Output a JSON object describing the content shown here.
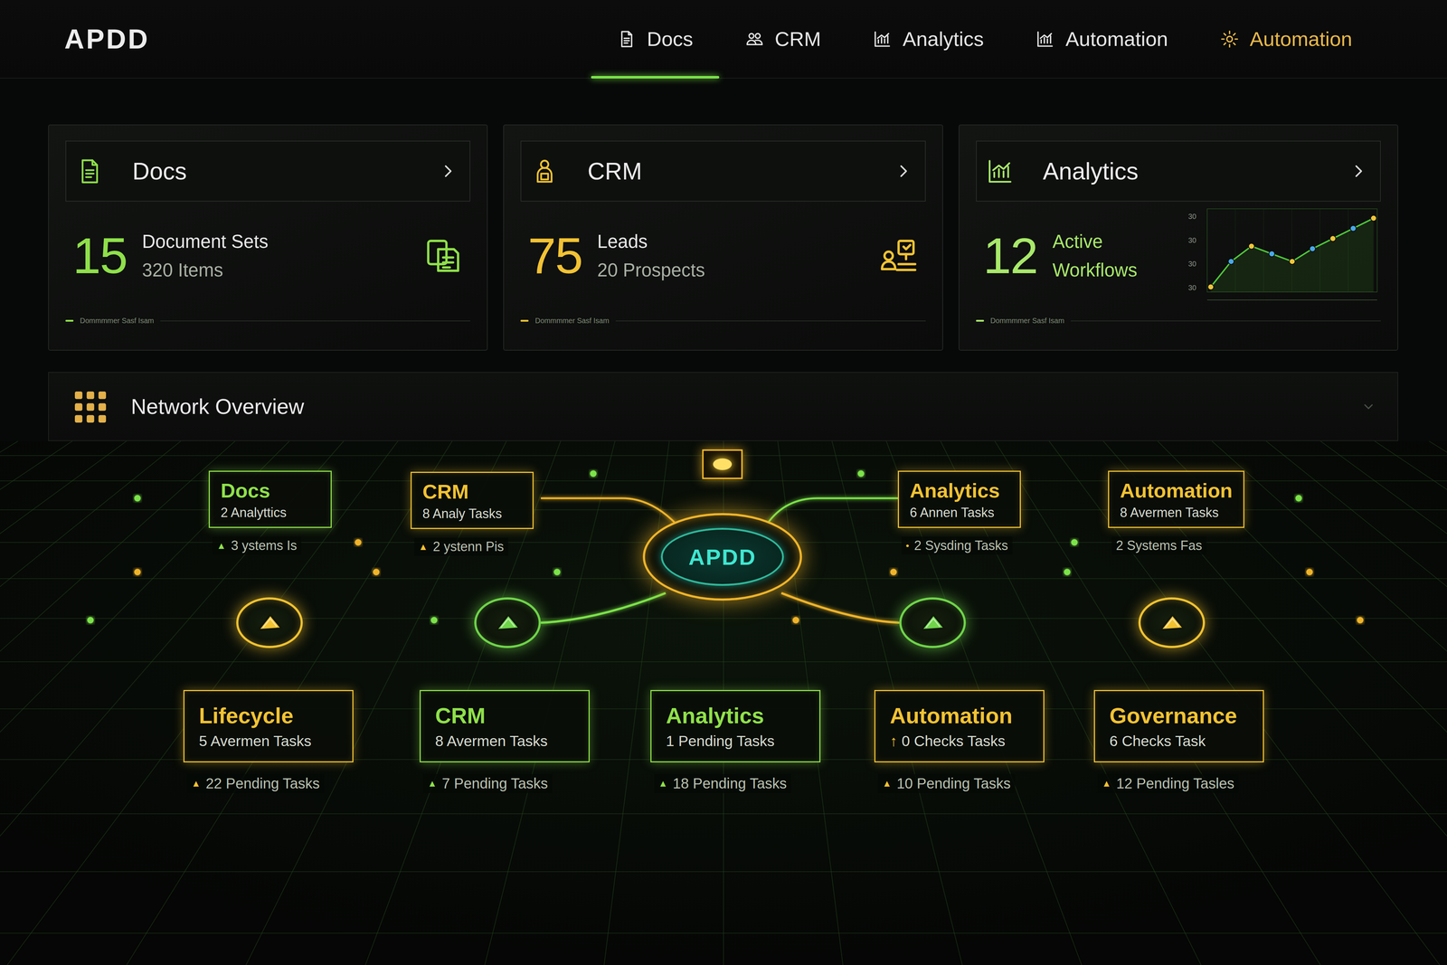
{
  "logo": "APDD",
  "nav": [
    {
      "label": "Docs",
      "selected": true,
      "color": "#e6e6e6"
    },
    {
      "label": "CRM",
      "selected": false,
      "color": "#e6e6e6"
    },
    {
      "label": "Analytics",
      "selected": false,
      "color": "#e6e6e6"
    },
    {
      "label": "Automation",
      "selected": false,
      "color": "#e6e6e6"
    },
    {
      "label": "Automation",
      "selected": false,
      "color": "#e8b84a"
    }
  ],
  "cards": [
    {
      "kind": "icon",
      "title": "Docs",
      "number": "15",
      "label": "Document Sets",
      "sublabel": "320 Items",
      "footer": "Dommmmer Sasf Isam",
      "color": "#8fe04a"
    },
    {
      "kind": "icon",
      "title": "CRM",
      "number": "75",
      "label": "Leads",
      "sublabel": "20 Prospects",
      "footer": "Dommmmer Sasf Isam",
      "color": "#f2c233"
    },
    {
      "kind": "chart",
      "title": "Analytics",
      "number": "12",
      "label": "Active",
      "sublabel": "Workflows",
      "footer": "Dommmmer Sasf Isam",
      "color": "#a8e86a",
      "chart": {
        "ticks": [
          "30",
          "30",
          "30",
          "30"
        ],
        "values": [
          2,
          12,
          18,
          15,
          12,
          17,
          21,
          25,
          29
        ]
      }
    }
  ],
  "network": {
    "title": "Network Overview",
    "hub": "APDD",
    "top_nodes": [
      {
        "title": "Docs",
        "sub": "2 Analyttics",
        "caption_icon": "▲",
        "caption": "3 ystems Is",
        "color": "#8fe04a"
      },
      {
        "title": "CRM",
        "sub": "8 Analy Tasks",
        "caption_icon": "▲",
        "caption": "2 ystenn Pis",
        "color": "#f2c233"
      },
      {
        "title": "Analytics",
        "sub": "6 Annen Tasks",
        "caption_icon": "•",
        "caption": "2 Sysding Tasks",
        "color": "#f2c233"
      },
      {
        "title": "Automation",
        "sub": "8 Avermen Tasks",
        "caption": "2 Systems Fas",
        "color": "#f2c233"
      }
    ],
    "pins": [
      {
        "color": "#f2c230"
      },
      {
        "color": "#6fd44a"
      },
      {
        "color": "#6fd44a"
      },
      {
        "color": "#f2c230"
      }
    ],
    "bottom_nodes": [
      {
        "title": "Lifecycle",
        "sub": "5 Avermen Tasks",
        "caption_icon": "▲",
        "caption": "22 Pending Tasks",
        "color": "#f2c233"
      },
      {
        "title": "CRM",
        "sub": "8 Avermen Tasks",
        "caption_icon": "▲",
        "caption": "7 Pending Tasks",
        "color": "#8fe04a"
      },
      {
        "title": "Analytics",
        "sub": "1 Pending Tasks",
        "caption_icon": "▲",
        "caption": "18 Pending Tasks",
        "color": "#8fe04a"
      },
      {
        "title": "Automation",
        "sub_icon": "↑",
        "sub": "0 Checks Tasks",
        "caption_icon": "▲",
        "caption": "10 Pending Tasks",
        "color": "#f2c233"
      },
      {
        "title": "Governance",
        "sub": "6 Checks Task",
        "caption_icon": "▲",
        "caption": "12 Pending Tasles",
        "color": "#f2c233"
      }
    ]
  }
}
